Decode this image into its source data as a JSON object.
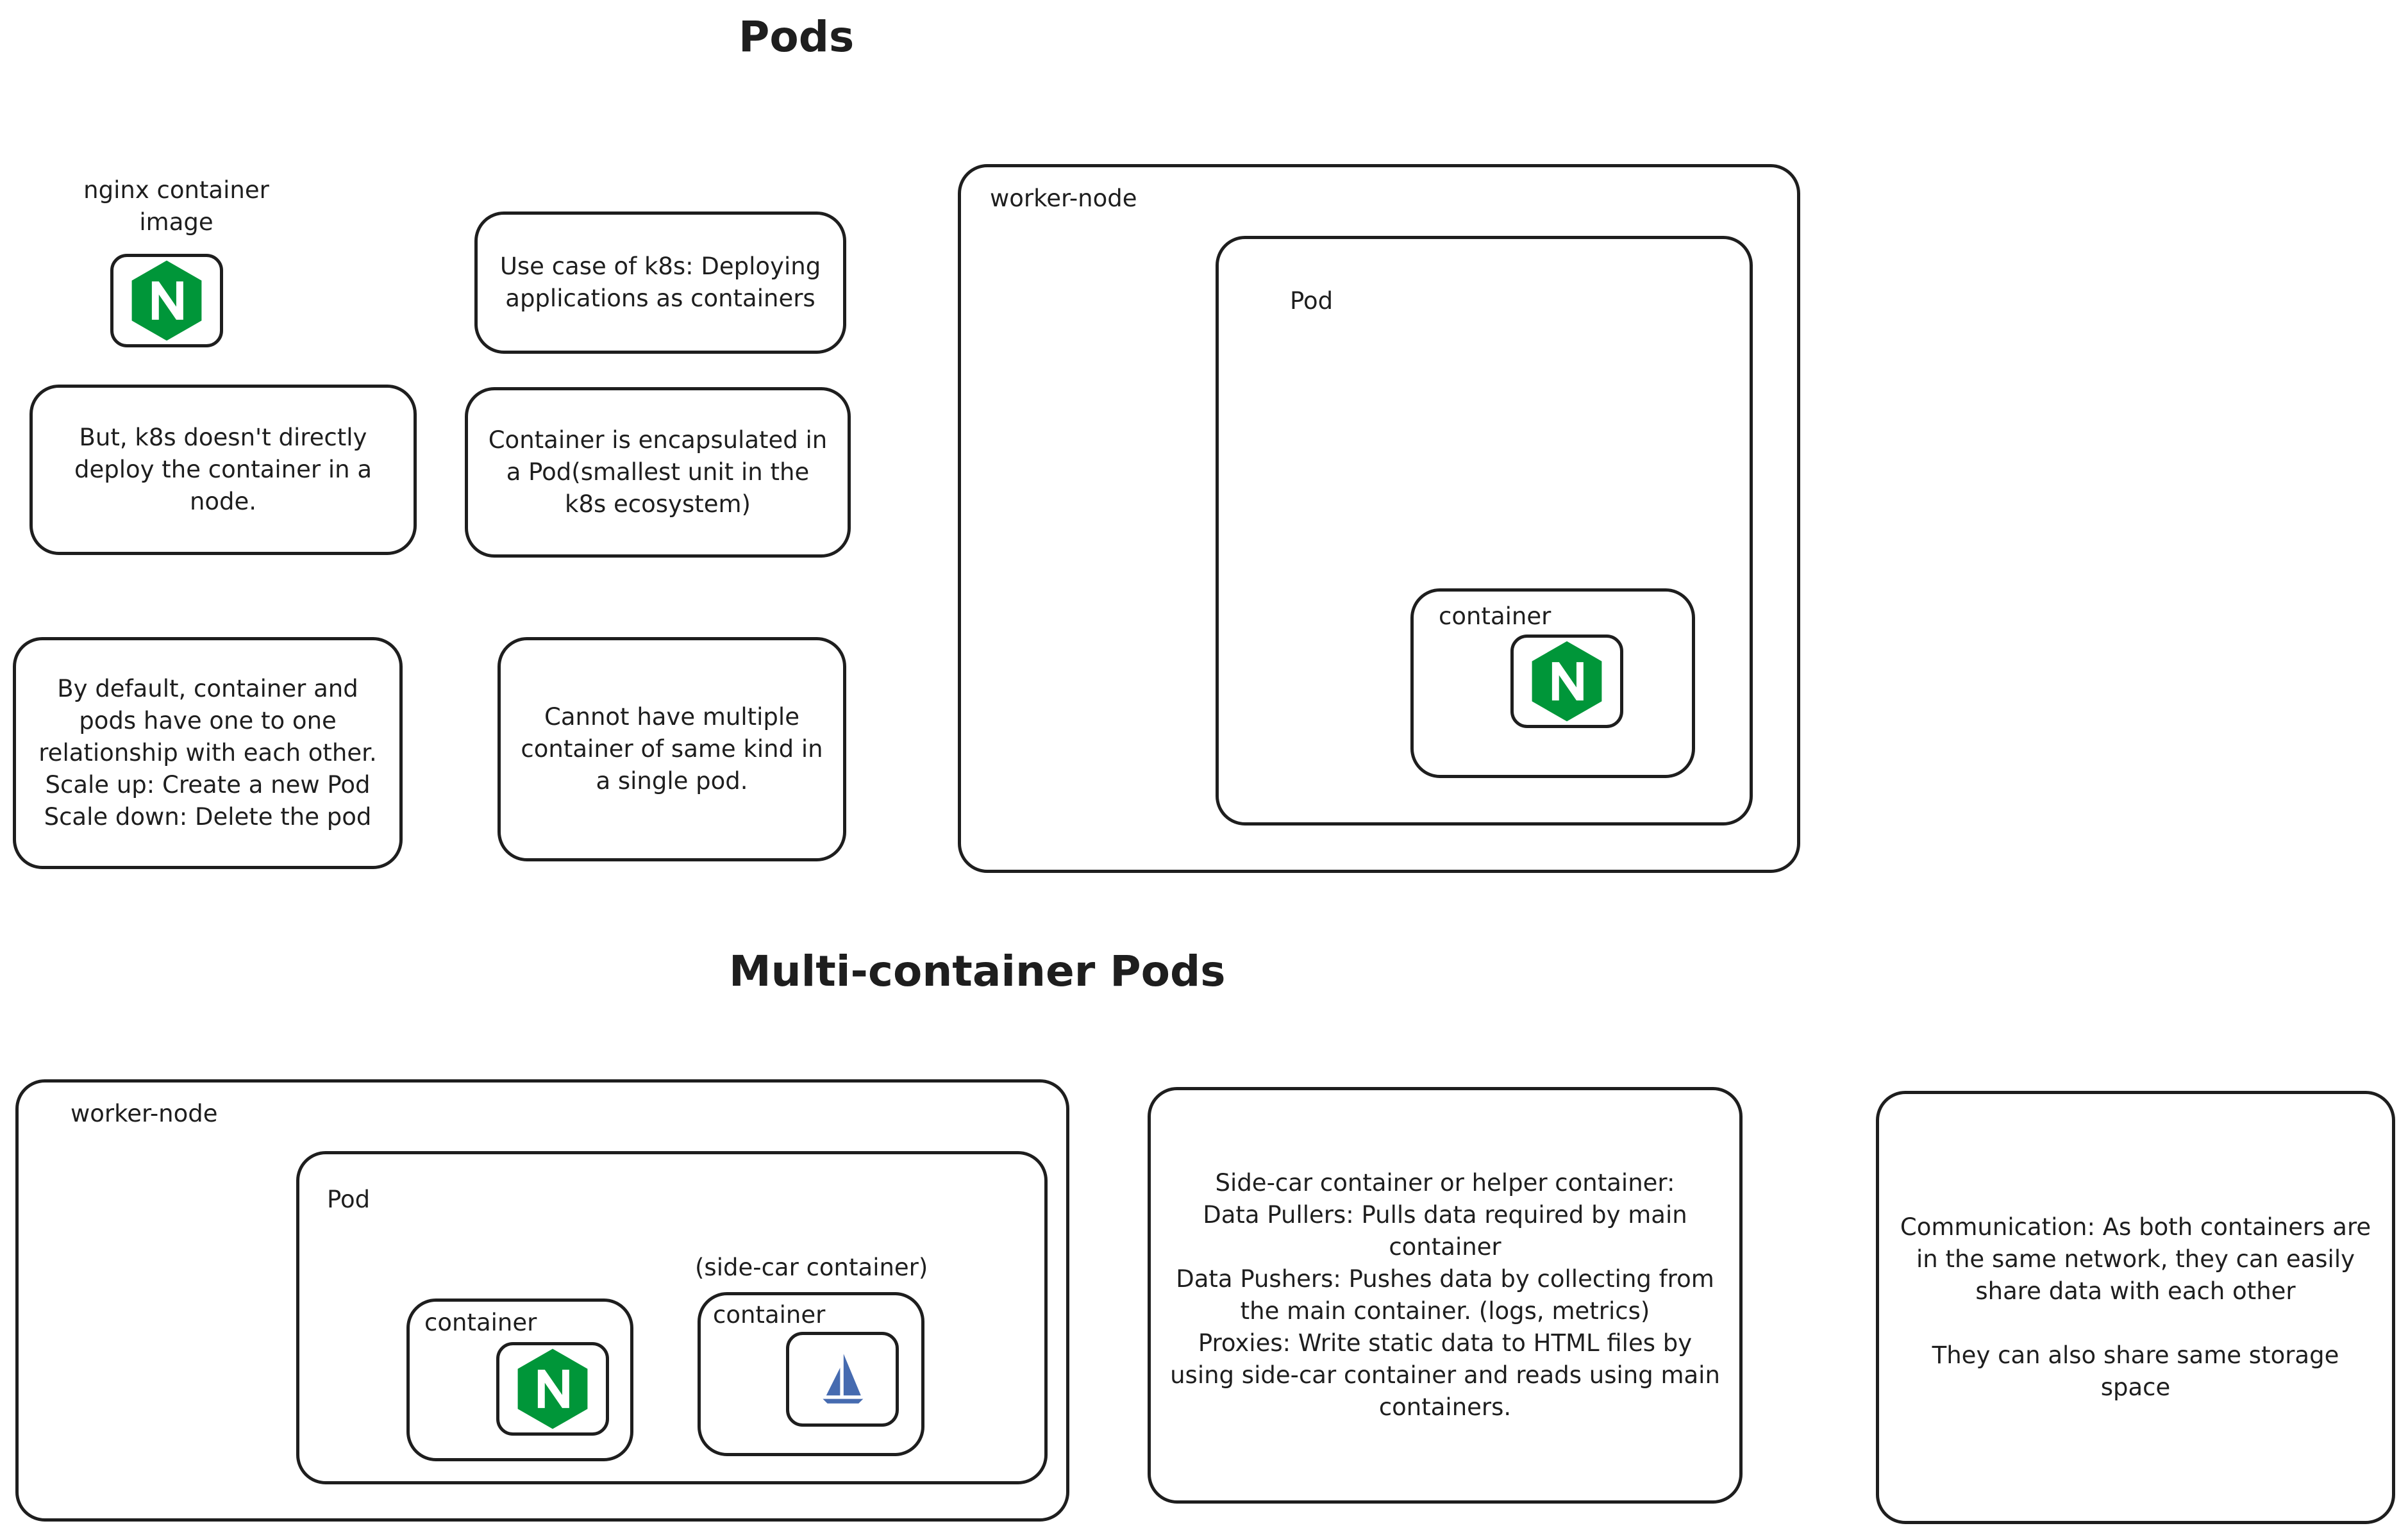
{
  "headings": {
    "pods": "Pods",
    "multi_container": "Multi-container Pods"
  },
  "nginx_image": {
    "caption": "nginx container\nimage",
    "icon": "nginx-logo-icon"
  },
  "notes": {
    "use_case": "Use case of k8s: Deploying\napplications as containers",
    "not_directly": "But, k8s doesn't directly\ndeploy the container in a\nnode.",
    "encapsulated": "Container is encapsulated in\na Pod(smallest unit in the\nk8s ecosystem)",
    "one_to_one": "By default, container and\npods have one to one\nrelationship with each other.\nScale up: Create a new Pod\nScale down: Delete the pod",
    "no_multiple": "Cannot have multiple\ncontainer of same kind in\na single pod.",
    "side_car": "Side-car container or helper container:\nData Pullers: Pulls data required by main\ncontainer\nData Pushers: Pushes data by collecting from\nthe main container. (logs, metrics)\nProxies: Write static data to HTML files by\nusing side-car container and reads using main\ncontainers.",
    "communication": "Communication: As both containers are\nin the same network, they can easily\nshare data with each other\n\nThey can also share same storage\nspace"
  },
  "diagram1": {
    "worker_node": "worker-node",
    "pod": "Pod",
    "container": "container",
    "icon": "nginx-logo-icon"
  },
  "diagram2": {
    "worker_node": "worker-node",
    "pod": "Pod",
    "main_container": "container",
    "sidecar_caption": "(side-car container)",
    "sidecar_container": "container",
    "main_icon": "nginx-logo-icon",
    "sidecar_icon": "sail-logo-icon"
  },
  "colors": {
    "stroke": "#1e1e1e",
    "nginx_green": "#009639",
    "sail_blue": "#466bb0"
  }
}
